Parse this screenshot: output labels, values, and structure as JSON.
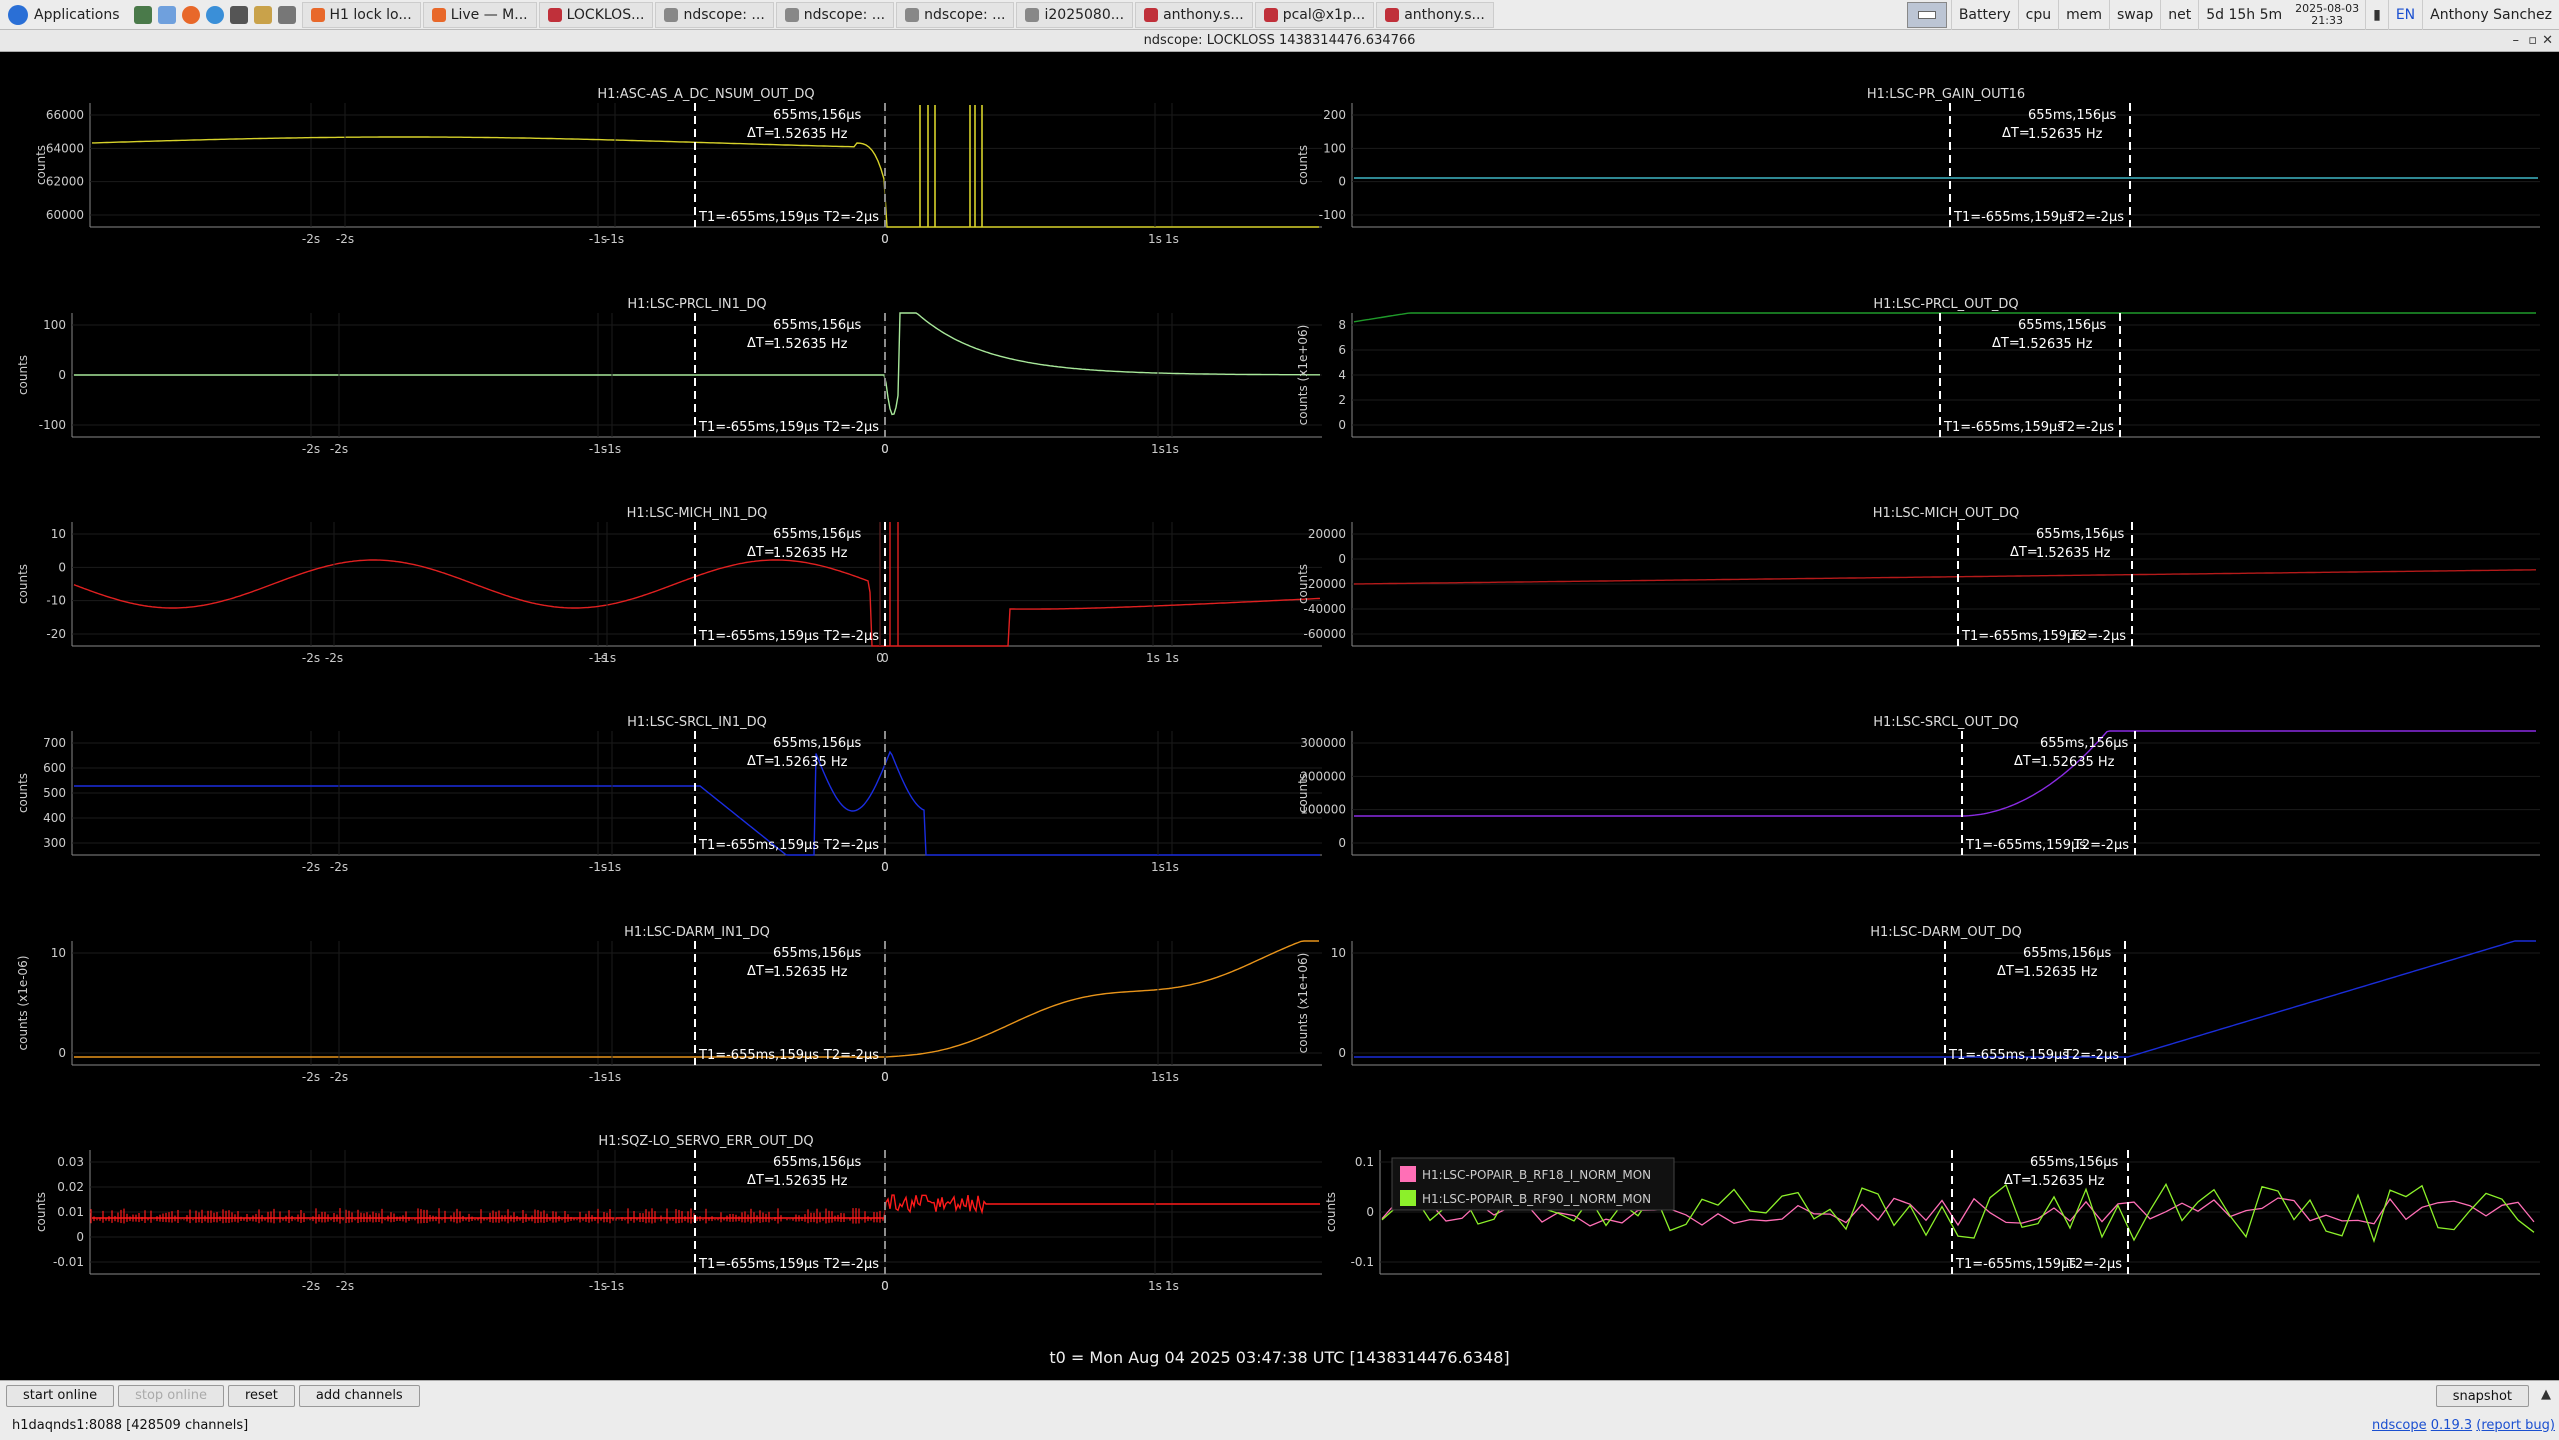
{
  "taskbar": {
    "applications_label": "Applications",
    "tasks": [
      "H1 lock lo...",
      "Live — M...",
      "LOCKLOS...",
      "ndscope: ...",
      "ndscope: ...",
      "ndscope: ...",
      "i2025080...",
      "anthony.s...",
      "pcal@x1p...",
      "anthony.s..."
    ],
    "tray": [
      "Battery",
      "cpu",
      "mem",
      "swap",
      "net"
    ],
    "uptime": "5d 15h 5m",
    "date": "2025-08-03",
    "time": "21:33",
    "lang": "EN",
    "user": "Anthony Sanchez"
  },
  "window": {
    "title": "ndscope: LOCKLOSS 1438314476.634766"
  },
  "cursors": {
    "dt_label": "ΔT=",
    "dt_value": "655ms,156μs",
    "freq": "1.52635 Hz",
    "t1": "T1=-655ms,159μs",
    "t2": "T2=-2μs"
  },
  "plots": [
    {
      "title": "H1:ASC-AS_A_DC_NSUM_OUT_DQ",
      "ylabel": "counts",
      "yticks": [
        "66000",
        "64000",
        "62000",
        "60000"
      ],
      "xticks": [
        "-2s",
        "-1s",
        "0",
        "1s"
      ],
      "color": "#d7d22a"
    },
    {
      "title": "H1:LSC-PR_GAIN_OUT16",
      "ylabel": "counts",
      "yticks": [
        "200",
        "100",
        "0",
        "-100"
      ],
      "xticks": [
        "-2s",
        "-1s",
        "0",
        "1s"
      ],
      "color": "#3fb6c4"
    },
    {
      "title": "H1:LSC-PRCL_IN1_DQ",
      "ylabel": "counts",
      "yticks": [
        "100",
        "0",
        "-100"
      ],
      "xticks": [
        "-2s",
        "-1s",
        "0",
        "1s"
      ],
      "color": "#a8e89a"
    },
    {
      "title": "H1:LSC-PRCL_OUT_DQ",
      "ylabel": "counts (x1e+06)",
      "yticks": [
        "8",
        "6",
        "4",
        "2",
        "0"
      ],
      "xticks": [
        "-2s",
        "-1s",
        "0",
        "1s"
      ],
      "color": "#1f9a2a"
    },
    {
      "title": "H1:LSC-MICH_IN1_DQ",
      "ylabel": "counts",
      "yticks": [
        "10",
        "0",
        "-10",
        "-20"
      ],
      "xticks": [
        "-2s",
        "-1s",
        "0",
        "1s"
      ],
      "color": "#e02020"
    },
    {
      "title": "H1:LSC-MICH_OUT_DQ",
      "ylabel": "counts",
      "yticks": [
        "20000",
        "0",
        "-20000",
        "-40000",
        "-60000"
      ],
      "xticks": [
        "-2s",
        "-1s",
        "0",
        "1s"
      ],
      "color": "#b51a1a"
    },
    {
      "title": "H1:LSC-SRCL_IN1_DQ",
      "ylabel": "counts",
      "yticks": [
        "700",
        "600",
        "500",
        "400",
        "300"
      ],
      "xticks": [
        "-2s",
        "-1s",
        "0",
        "1s"
      ],
      "color": "#1a2de0"
    },
    {
      "title": "H1:LSC-SRCL_OUT_DQ",
      "ylabel": "counts",
      "yticks": [
        "300000",
        "200000",
        "100000",
        "0"
      ],
      "xticks": [
        "-2s",
        "-1s",
        "0",
        "1s"
      ],
      "color": "#8a2be2"
    },
    {
      "title": "H1:LSC-DARM_IN1_DQ",
      "ylabel": "counts (x1e-06)",
      "yticks": [
        "10",
        "0"
      ],
      "xticks": [
        "-2s",
        "-1s",
        "0",
        "1s"
      ],
      "color": "#e8941a"
    },
    {
      "title": "H1:LSC-DARM_OUT_DQ",
      "ylabel": "counts (x1e+06)",
      "yticks": [
        "10",
        "0"
      ],
      "xticks": [
        "-2s",
        "-1s",
        "0",
        "1s"
      ],
      "color": "#1a2dd8"
    },
    {
      "title": "H1:SQZ-LO_SERVO_ERR_OUT_DQ",
      "ylabel": "counts",
      "yticks": [
        "0.03",
        "0.02",
        "0.01",
        "0",
        "-0.01"
      ],
      "xticks": [
        "-2s",
        "-1s",
        "0",
        "1s"
      ],
      "color": "#ff1a1a"
    },
    {
      "title": "",
      "ylabel": "counts",
      "yticks": [
        "0.1",
        "0",
        "-0.1"
      ],
      "xticks": [
        "-2s",
        "-1s",
        "0",
        "1s"
      ],
      "color": "#9be82a",
      "legend": [
        {
          "name": "H1:LSC-POPAIR_B_RF18_I_NORM_MON",
          "color": "#ff6fb6"
        },
        {
          "name": "H1:LSC-POPAIR_B_RF90_I_NORM_MON",
          "color": "#8cf02a"
        }
      ]
    }
  ],
  "t0_label": "t0 = Mon Aug 04 2025 03:47:38 UTC [1438314476.6348]",
  "buttons": {
    "start_online": "start online",
    "stop_online": "stop online",
    "reset": "reset",
    "add_channels": "add channels",
    "snapshot": "snapshot"
  },
  "status": {
    "server": "h1daqnds1:8088",
    "channels": "[428509 channels]",
    "version_prefix": "ndscope",
    "version": "0.19.3",
    "report_bug": "(report bug)"
  }
}
